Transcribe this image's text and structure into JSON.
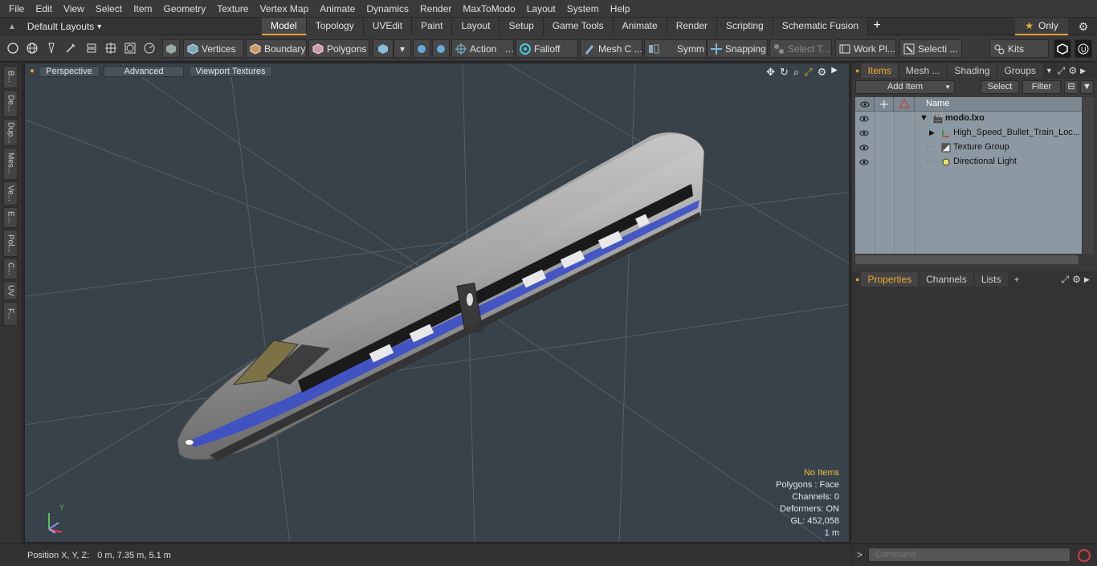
{
  "menu": [
    "File",
    "Edit",
    "View",
    "Select",
    "Item",
    "Geometry",
    "Texture",
    "Vertex Map",
    "Animate",
    "Dynamics",
    "Render",
    "MaxToModo",
    "Layout",
    "System",
    "Help"
  ],
  "layout": {
    "label": "Default Layouts"
  },
  "tabs": [
    "Model",
    "Topology",
    "UVEdit",
    "Paint",
    "Layout",
    "Setup",
    "Game Tools",
    "Animate",
    "Render",
    "Scripting",
    "Schematic Fusion"
  ],
  "active_tab": "Model",
  "only_label": "Only",
  "toolbar": {
    "vertices": "Vertices",
    "boundary": "Boundary",
    "polygons": "Polygons",
    "action": "Action",
    "falloff": "Falloff",
    "mesh_c": "Mesh C ...",
    "symm": "Symm ...",
    "snapping": "Snapping",
    "select_t": "Select T...",
    "work_pl": "Work Pl...",
    "selecti": "Selecti ...",
    "kits": "Kits"
  },
  "left_tabs": [
    "B...",
    "De...",
    "Dup...",
    "Mes...",
    "Ve...",
    "E...",
    "Pol...",
    "C...",
    "UV",
    "F..."
  ],
  "viewport": {
    "view": "Perspective",
    "mode": "Advanced",
    "textures": "Viewport Textures",
    "info": {
      "items": "No Items",
      "polygons": "Polygons : Face",
      "channels": "Channels: 0",
      "deformers": "Deformers: ON",
      "gl": "GL: 452,058",
      "scale": "1 m"
    },
    "axis": {
      "y": "Y"
    }
  },
  "status": {
    "label": "Position X, Y, Z:",
    "value": "0 m, 7.35 m, 5.1 m"
  },
  "items_panel": {
    "tabs": [
      "Items",
      "Mesh ...",
      "Shading",
      "Groups"
    ],
    "active": "Items",
    "add_item": "Add Item",
    "select": "Select",
    "filter": "Filter",
    "name_col": "Name",
    "rows": [
      {
        "label": "modo.lxo"
      },
      {
        "label": "High_Speed_Bullet_Train_Loc..."
      },
      {
        "label": "Texture Group"
      },
      {
        "label": "Directional Light"
      }
    ]
  },
  "props_panel": {
    "tabs": [
      "Properties",
      "Channels",
      "Lists"
    ],
    "active": "Properties"
  },
  "command": {
    "placeholder": "Command"
  },
  "colors": {
    "accent": "#e0a030",
    "viewport_bg": "#38424a",
    "list_bg": "#8d99a2"
  }
}
